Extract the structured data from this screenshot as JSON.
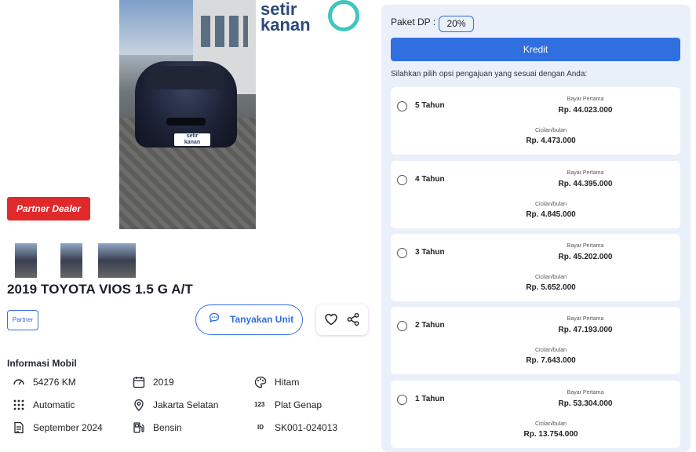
{
  "brand": {
    "logo_text_line1": "setir",
    "logo_text_line2": "kanan"
  },
  "gallery": {
    "badge": "Partner Dealer",
    "plate_line1": "setir",
    "plate_line2": "kanan"
  },
  "listing": {
    "title": "2019 TOYOTA VIOS 1.5 G A/T",
    "partner_badge": "Partner",
    "ask_button": "Tanyakan Unit"
  },
  "info": {
    "title": "Informasi Mobil",
    "specs": [
      {
        "icon": "speedometer-icon",
        "value": "54276 KM"
      },
      {
        "icon": "calendar-icon",
        "value": "2019"
      },
      {
        "icon": "palette-icon",
        "value": "Hitam"
      },
      {
        "icon": "transmission-icon",
        "value": "Automatic"
      },
      {
        "icon": "location-icon",
        "value": "Jakarta Selatan"
      },
      {
        "icon": "number-icon",
        "icon_text": "123",
        "value": "Plat Genap"
      },
      {
        "icon": "document-icon",
        "value": "September 2024"
      },
      {
        "icon": "fuel-icon",
        "value": "Bensin"
      },
      {
        "icon": "id-icon",
        "icon_text": "ID",
        "value": "SK001-024013"
      }
    ]
  },
  "credit": {
    "dp_label": "Paket DP :",
    "dp_value": "20%",
    "kredit_button": "Kredit",
    "hint": "Silahkan pilih opsi pengajuan yang sesuai dengan Anda:",
    "first_payment_label": "Bayar Pertama",
    "monthly_label": "Cicilan/bulan",
    "options": [
      {
        "term": "5 Tahun",
        "first_payment": "Rp. 44.023.000",
        "monthly": "Rp. 4.473.000"
      },
      {
        "term": "4 Tahun",
        "first_payment": "Rp. 44.395.000",
        "monthly": "Rp. 4.845.000"
      },
      {
        "term": "3 Tahun",
        "first_payment": "Rp. 45.202.000",
        "monthly": "Rp. 5.652.000"
      },
      {
        "term": "2 Tahun",
        "first_payment": "Rp. 47.193.000",
        "monthly": "Rp. 7.643.000"
      },
      {
        "term": "1 Tahun",
        "first_payment": "Rp. 53.304.000",
        "monthly": "Rp. 13.754.000"
      }
    ]
  },
  "colors": {
    "primary": "#2f6fe0",
    "danger": "#e0292b",
    "panel": "#e9f0f9",
    "brand_teal": "#3ec6c0",
    "brand_navy": "#2c4a79"
  }
}
